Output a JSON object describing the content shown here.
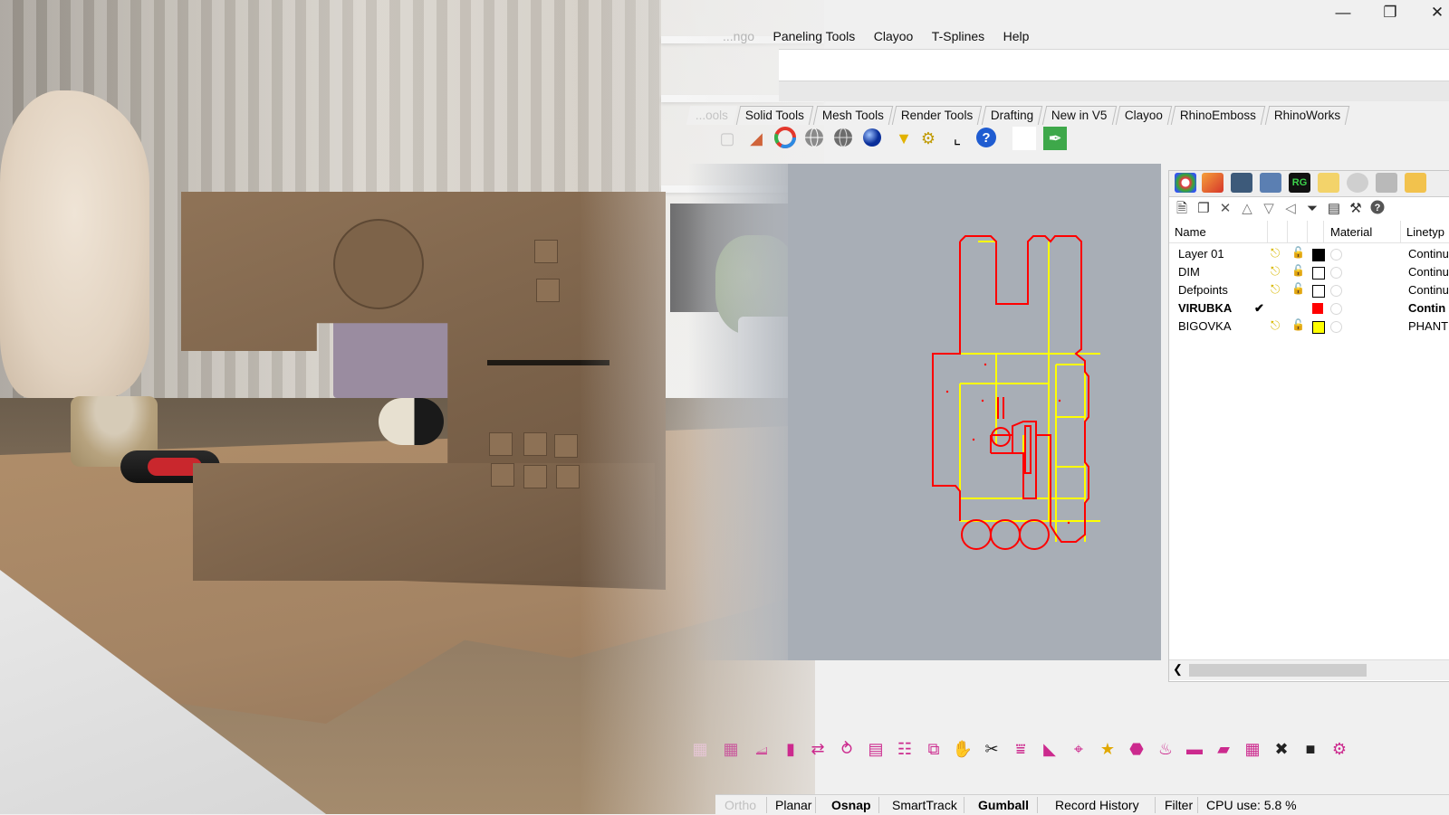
{
  "window": {
    "minimize_icon": "minimize-icon",
    "restore_icon": "restore-icon",
    "close_icon": "close-icon"
  },
  "menu": [
    "...ngo",
    "Paneling Tools",
    "Clayoo",
    "T-Splines",
    "Help"
  ],
  "toolbar_tabs": [
    "...ools",
    "Solid Tools",
    "Mesh Tools",
    "Render Tools",
    "Drafting",
    "New in V5",
    "Clayoo",
    "RhinoEmboss",
    "RhinoWorks"
  ],
  "layers_panel": {
    "columns": [
      "Name",
      "Material",
      "Linetyp"
    ],
    "rows": [
      {
        "name": "Layer 01",
        "current": false,
        "color": "#000000",
        "linetype": "Continu"
      },
      {
        "name": "DIM",
        "current": false,
        "color": "#ffffff",
        "linetype": "Continu"
      },
      {
        "name": "Defpoints",
        "current": false,
        "color": "#ffffff",
        "linetype": "Continu"
      },
      {
        "name": "VIRUBKA",
        "current": true,
        "check": "✔",
        "color": "#ff0000",
        "linetype": "Contin"
      },
      {
        "name": "BIGOVKA",
        "current": false,
        "color": "#ffff00",
        "linetype": "PHANT"
      }
    ]
  },
  "statusbar": {
    "ortho": "Ortho",
    "planar": "Planar",
    "osnap": "Osnap",
    "smarttrack": "SmartTrack",
    "gumball": "Gumball",
    "record_history": "Record History",
    "filter": "Filter",
    "cpu": "CPU use: 5.8 %"
  },
  "colors": {
    "viewport_bg": "#a8aeb6",
    "cut_line": "#ff0000",
    "fold_line": "#ffff00"
  }
}
